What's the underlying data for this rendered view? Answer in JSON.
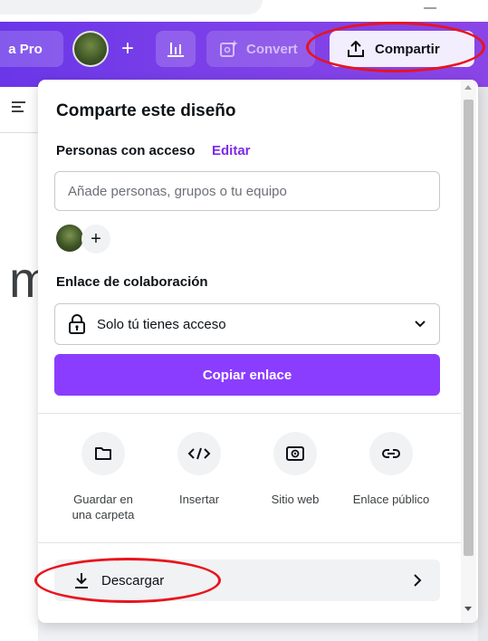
{
  "toolbar": {
    "pro_label": "a Pro",
    "add_label": "+",
    "convert_label": "Convert",
    "share_label": "Compartir"
  },
  "editor": {
    "letter": "m"
  },
  "share_panel": {
    "title": "Comparte este diseño",
    "access_label": "Personas con acceso",
    "edit_link": "Editar",
    "people_input_placeholder": "Añade personas, grupos o tu equipo",
    "add_person_label": "+",
    "collab_link_label": "Enlace de colaboración",
    "access_select_value": "Solo tú tienes acceso",
    "copy_link_button": "Copiar enlace",
    "options": [
      {
        "label_line1": "Guardar en",
        "label_line2": "una carpeta",
        "icon": "folder-icon"
      },
      {
        "label_line1": "Insertar",
        "label_line2": "",
        "icon": "code-icon"
      },
      {
        "label_line1": "Sitio web",
        "label_line2": "",
        "icon": "website-icon"
      },
      {
        "label_line1": "Enlace público",
        "label_line2": "",
        "icon": "link-icon"
      }
    ],
    "download_label": "Descargar"
  },
  "colors": {
    "brand_purple": "#8b3dff",
    "link_purple": "#7d2ae8",
    "annotation_red": "#e8141e"
  }
}
